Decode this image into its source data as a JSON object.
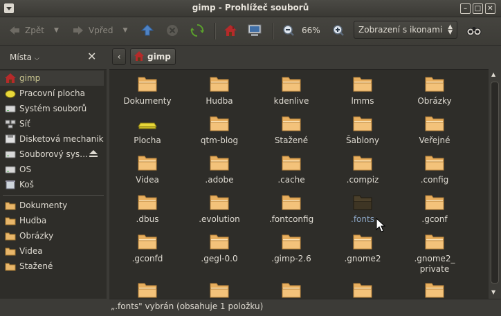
{
  "window": {
    "title": "gimp - Prohlížeč souborů"
  },
  "toolbar": {
    "back_label": "Zpět",
    "forward_label": "Vpřed",
    "zoom_level": "66%",
    "view_mode": "Zobrazení s ikonami"
  },
  "sidebar": {
    "header": "Místa",
    "places": [
      {
        "label": "gimp",
        "icon": "home-icon",
        "selected": true
      },
      {
        "label": "Pracovní plocha",
        "icon": "desktop-icon"
      },
      {
        "label": "Systém souborů",
        "icon": "drive-icon"
      },
      {
        "label": "Síť",
        "icon": "network-icon"
      },
      {
        "label": "Disketová mechanika",
        "icon": "floppy-icon"
      },
      {
        "label": "Souborový sys…",
        "icon": "drive-icon",
        "eject": true
      },
      {
        "label": "OS",
        "icon": "drive-icon"
      },
      {
        "label": "Koš",
        "icon": "trash-icon"
      }
    ],
    "bookmarks": [
      {
        "label": "Dokumenty",
        "icon": "folder-icon"
      },
      {
        "label": "Hudba",
        "icon": "folder-icon"
      },
      {
        "label": "Obrázky",
        "icon": "folder-icon"
      },
      {
        "label": "Videa",
        "icon": "folder-icon"
      },
      {
        "label": "Stažené",
        "icon": "folder-icon"
      }
    ]
  },
  "pathbar": {
    "current": "gimp"
  },
  "files": [
    "Dokumenty",
    "Hudba",
    "kdenlive",
    "lmms",
    "Obrázky",
    "Plocha",
    "qtm-blog",
    "Stažené",
    "Šablony",
    "Veřejné",
    "Videa",
    ".adobe",
    ".cache",
    ".compiz",
    ".config",
    ".dbus",
    ".evolution",
    ".fontconfig",
    ".fonts",
    ".gconf",
    ".gconfd",
    ".gegl-0.0",
    ".gimp-2.6",
    ".gnome2",
    ".gnome2_\nprivate",
    "",
    "",
    "",
    "",
    ""
  ],
  "selected_file": ".fonts",
  "status": {
    "text": "„.fonts\" vybrán (obsahuje 1 položku)"
  }
}
